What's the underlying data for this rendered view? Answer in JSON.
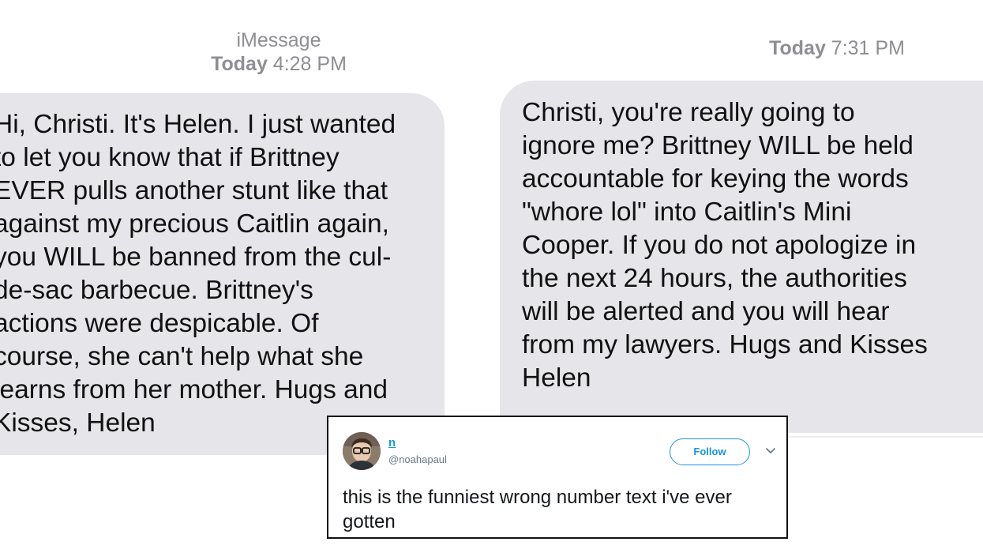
{
  "left_conversation": {
    "service_label": "iMessage",
    "timestamp_day": "Today",
    "timestamp_time": "4:28 PM",
    "message_lines": [
      "Hi, Christi. It's Helen. I just wanted",
      "to let you know that if Brittney",
      "EVER pulls another stunt like that",
      "against my precious Caitlin again,",
      "you WILL be banned from the cul-",
      "de-sac barbecue. Brittney's",
      "actions were despicable. Of",
      "course, she can't help what she",
      "learns from her mother. Hugs and",
      "Kisses, Helen"
    ]
  },
  "right_conversation": {
    "timestamp_day": "Today",
    "timestamp_time": "7:31 PM",
    "message_lines": [
      "Christi, you're really going to",
      "ignore me? Brittney WILL be held",
      "accountable for keying the words",
      "\"whore lol\" into Caitlin's Mini",
      "Cooper. If you do not apologize in",
      "the next 24 hours, the authorities",
      "will be alerted and you will hear",
      "from my lawyers. Hugs and Kisses",
      "Helen"
    ]
  },
  "tweet": {
    "display_name": "n",
    "handle": "@noahapaul",
    "follow_label": "Follow",
    "text": "this is the funniest wrong number text i've ever gotten",
    "avatar_icon": "person-glasses-avatar",
    "menu_icon": "chevron-down-icon",
    "accent_color": "#1b95e0"
  },
  "colors": {
    "bubble_received": "#e5e5ea",
    "timestamp_gray": "#8e8e93"
  }
}
